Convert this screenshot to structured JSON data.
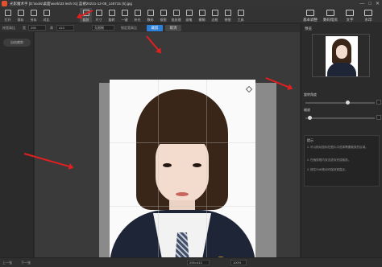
{
  "window": {
    "title": "光影魔术手 [D:\\tools\\桌面\\work\\33 lesh 01] 蓝裙20221-12-08_145715 (5).jpg",
    "controls": [
      "—",
      "□",
      "✕"
    ]
  },
  "toolbar": {
    "tools": [
      {
        "label": "打开",
        "icon": "folder-icon"
      },
      {
        "label": "保存",
        "icon": "save-icon"
      },
      {
        "label": "另存",
        "icon": "save-as-icon"
      },
      {
        "label": "对比",
        "icon": "compare-icon"
      },
      {
        "label": "裁剪",
        "icon": "crop-icon"
      },
      {
        "label": "尺寸",
        "icon": "resize-icon"
      },
      {
        "label": "旋转",
        "icon": "rotate-icon"
      },
      {
        "label": "一键",
        "icon": "magic-icon"
      },
      {
        "label": "补光",
        "icon": "light-icon"
      },
      {
        "label": "数码",
        "icon": "digital-icon"
      },
      {
        "label": "抠图",
        "icon": "cutout-icon"
      },
      {
        "label": "批处理",
        "icon": "batch-icon"
      },
      {
        "label": "画笔",
        "icon": "brush-icon"
      },
      {
        "label": "模糊",
        "icon": "blur-icon"
      },
      {
        "label": "边框",
        "icon": "frame-icon"
      },
      {
        "label": "拼图",
        "icon": "collage-icon"
      },
      {
        "label": "工具",
        "icon": "tools-icon"
      }
    ],
    "active_tool": "裁剪",
    "right_tools": [
      {
        "label": "基本调整",
        "icon": "adjust-icon"
      },
      {
        "label": "数码暗房",
        "icon": "darkroom-icon"
      },
      {
        "label": "文字",
        "icon": "text-icon"
      },
      {
        "label": "水印",
        "icon": "watermark-icon"
      }
    ]
  },
  "options": {
    "ratio_label": "按宽高比",
    "width_label": "宽",
    "width_value": "295",
    "height_label": "高",
    "height_value": "413",
    "unit_value": "无限制",
    "lock_label": "锁定宽高比",
    "apply_label": "裁剪",
    "cancel_label": "取消"
  },
  "left_panel": {
    "pill_label": "自由裁剪"
  },
  "right_panel": {
    "title": "预览",
    "rotate_label": "旋转角度",
    "rotate_value": "0°",
    "zoom_label": "缩放",
    "zoom_value": "0",
    "tip_title": "提示",
    "tip_lines": [
      "1. 可以拖动鼠标在图片中选择需要裁剪的区域。",
      "2. 在裁剪框内双击鼠标完成裁剪。",
      "3. 按住Shift拖动可保持宽高比。"
    ]
  },
  "statusbar": {
    "page_prev": "上一张",
    "page_next": "下一张",
    "size_value": "295×413",
    "zoom_percent": "100%"
  },
  "colors": {
    "accent": "#2e7fd6",
    "annotation": "#e02020",
    "background": "#2b2b2b"
  }
}
